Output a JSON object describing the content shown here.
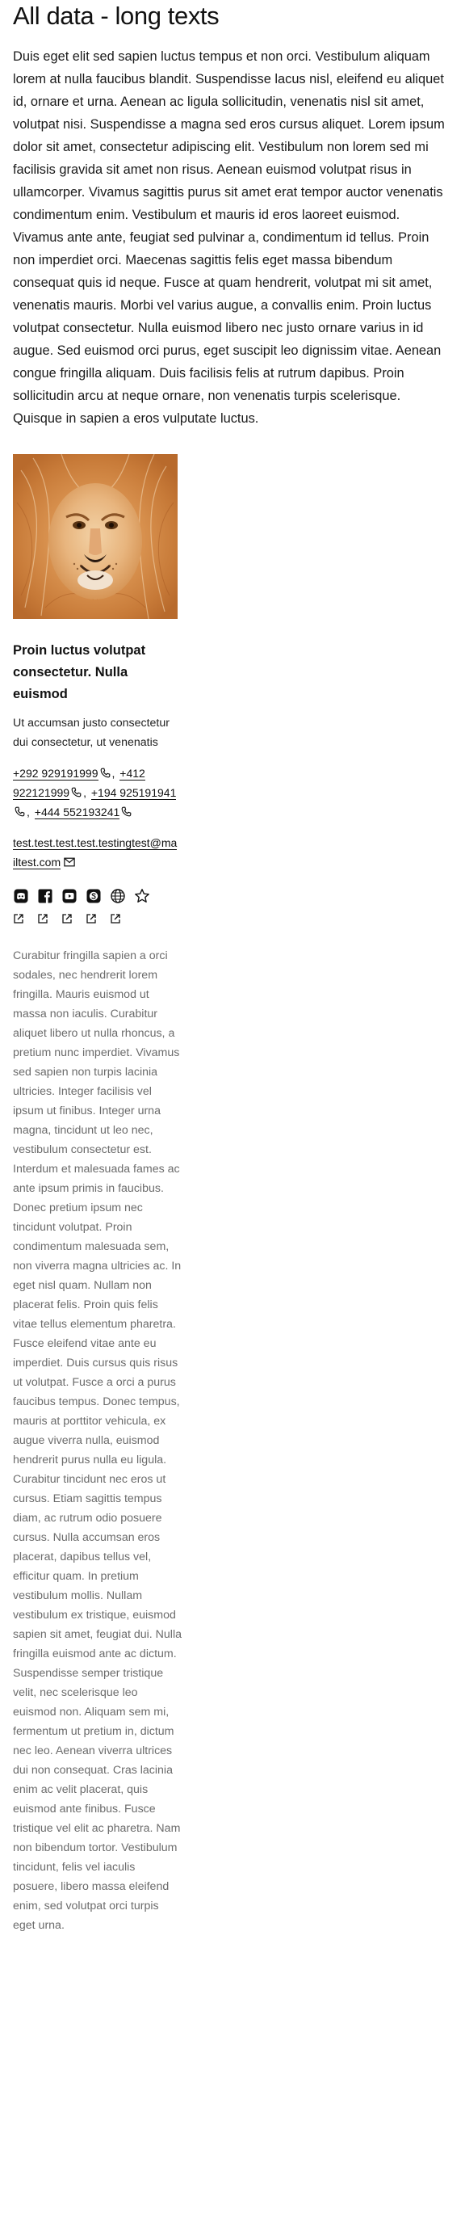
{
  "page": {
    "title": "All data - long texts",
    "intro": "Duis eget elit sed sapien luctus tempus et non orci. Vestibulum aliquam lorem at nulla faucibus blandit. Suspendisse lacus nisl, eleifend eu aliquet id, ornare et urna. Aenean ac ligula sollicitudin, venenatis nisl sit amet, volutpat nisi. Suspendisse a magna sed eros cursus aliquet. Lorem ipsum dolor sit amet, consectetur adipiscing elit. Vestibulum non lorem sed mi facilisis gravida sit amet non risus. Aenean euismod volutpat risus in ullamcorper. Vivamus sagittis purus sit amet erat tempor auctor venenatis condimentum enim. Vestibulum et mauris id eros laoreet euismod. Vivamus ante ante, feugiat sed pulvinar a, condimentum id tellus. Proin non imperdiet orci. Maecenas sagittis felis eget massa bibendum consequat quis id neque. Fusce at quam hendrerit, volutpat mi sit amet, venenatis mauris. Morbi vel varius augue, a convallis enim. Proin luctus volutpat consectetur. Nulla euismod libero nec justo ornare varius in id augue. Sed euismod orci purus, eget suscipit leo dignissim vitae. Aenean congue fringilla aliquam. Duis facilisis felis at rutrum dapibus. Proin sollicitudin arcu at neque ornare, non venenatis turpis scelerisque. Quisque in sapien a eros vulputate luctus."
  },
  "card": {
    "photo_icon": "lion-photo",
    "title": "Proin luctus volutpat consectetur. Nulla euismod",
    "subtitle": "Ut accumsan justo consectetur dui consectetur, ut venenatis",
    "phones": [
      "+292 929191999",
      "+412 922121999",
      "+194 925191941",
      "+444 552193241"
    ],
    "phone_separator": ",",
    "email": "test.test.test.test.testingtest@mailtest.com",
    "socials": [
      {
        "icon": "discord-icon"
      },
      {
        "icon": "facebook-icon"
      },
      {
        "icon": "youtube-icon"
      },
      {
        "icon": "skype-icon"
      },
      {
        "icon": "globe-icon"
      },
      {
        "icon": "star-icon"
      }
    ],
    "external_link_icon": "external-link-icon",
    "body": "Curabitur fringilla sapien a orci sodales, nec hendrerit lorem fringilla. Mauris euismod ut massa non iaculis. Curabitur aliquet libero ut nulla rhoncus, a pretium nunc imperdiet. Vivamus sed sapien non turpis lacinia ultricies. Integer facilisis vel ipsum ut finibus. Integer urna magna, tincidunt ut leo nec, vestibulum consectetur est. Interdum et malesuada fames ac ante ipsum primis in faucibus. Donec pretium ipsum nec tincidunt volutpat. Proin condimentum malesuada sem, non viverra magna ultricies ac. In eget nisl quam. Nullam non placerat felis. Proin quis felis vitae tellus elementum pharetra. Fusce eleifend vitae ante eu imperdiet. Duis cursus quis risus ut volutpat. Fusce a orci a purus faucibus tempus. Donec tempus, mauris at porttitor vehicula, ex augue viverra nulla, euismod hendrerit purus nulla eu ligula. Curabitur tincidunt nec eros ut cursus. Etiam sagittis tempus diam, ac rutrum odio posuere cursus. Nulla accumsan eros placerat, dapibus tellus vel, efficitur quam. In pretium vestibulum mollis. Nullam vestibulum ex tristique, euismod sapien sit amet, feugiat dui. Nulla fringilla euismod ante ac dictum. Suspendisse semper tristique velit, nec scelerisque leo euismod non. Aliquam sem mi, fermentum ut pretium in, dictum nec leo. Aenean viverra ultrices dui non consequat. Cras lacinia enim ac velit placerat, quis euismod ante finibus. Fusce tristique vel elit ac pharetra. Nam non bibendum tortor. Vestibulum tincidunt, felis vel iaculis posuere, libero massa eleifend enim, sed volutpat orci turpis eget urna."
  }
}
